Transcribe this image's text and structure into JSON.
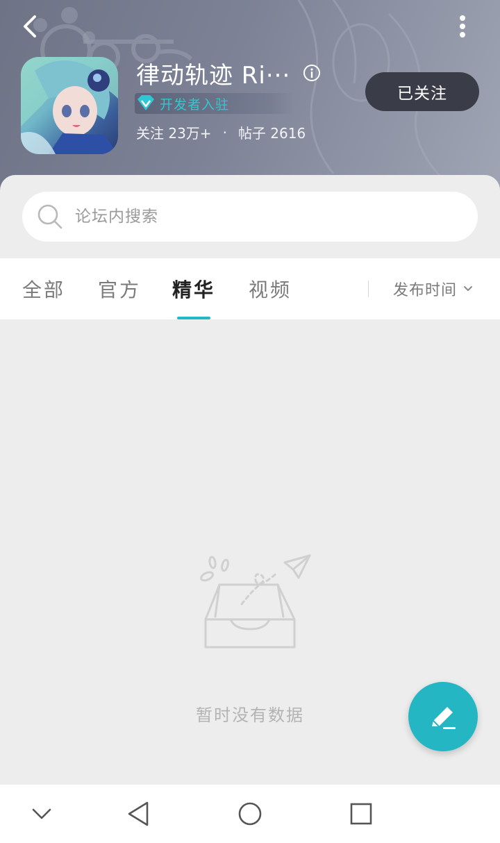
{
  "header": {
    "title": "律动轨迹 Ri···",
    "badge_label": "开发者入驻",
    "follow_stat": "关注 23万+",
    "separator": "·",
    "post_stat": "帖子 2616",
    "follow_button": "已关注",
    "back_icon": "back-arrow-icon",
    "more_icon": "more-vertical-icon",
    "info_icon": "info-icon"
  },
  "search": {
    "placeholder": "论坛内搜索",
    "icon": "search-icon"
  },
  "tabs": {
    "items": [
      {
        "label": "全部"
      },
      {
        "label": "官方"
      },
      {
        "label": "精华"
      },
      {
        "label": "视频"
      }
    ],
    "active_index": 2,
    "sort_label": "发布时间"
  },
  "empty_state": {
    "message": "暂时没有数据",
    "icon": "empty-inbox-icon"
  },
  "fab": {
    "icon": "pen-icon"
  },
  "nav": {
    "icons": [
      "chevron-down-icon",
      "nav-back-icon",
      "nav-home-icon",
      "nav-recents-icon"
    ]
  },
  "colors": {
    "accent": "#23b8c6",
    "header_bg": "#7d8296",
    "follow_button_bg": "#3a3d47",
    "badge_text": "#34c6cf",
    "page_bg": "#ededed"
  }
}
